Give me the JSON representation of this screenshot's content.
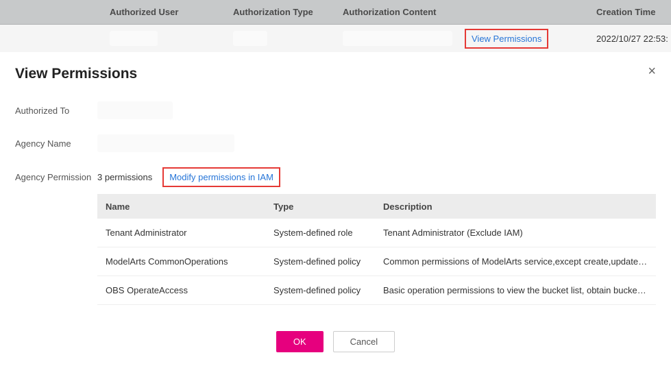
{
  "main_table": {
    "headers": {
      "user": "Authorized User",
      "type": "Authorization Type",
      "content": "Authorization Content",
      "time": "Creation Time"
    },
    "row": {
      "view_link": "View Permissions",
      "time": "2022/10/27 22:53:"
    }
  },
  "dialog": {
    "title": "View Permissions",
    "close": "×",
    "fields": {
      "authorized_to_label": "Authorized To",
      "agency_name_label": "Agency Name",
      "agency_permission_label": "Agency Permission",
      "permission_count": "3 permissions",
      "modify_link": "Modify permissions in IAM"
    },
    "perm_table": {
      "headers": {
        "name": "Name",
        "type": "Type",
        "desc": "Description"
      },
      "rows": [
        {
          "name": "Tenant Administrator",
          "type": "System-defined role",
          "desc": "Tenant Administrator (Exclude IAM)"
        },
        {
          "name": "ModelArts CommonOperations",
          "type": "System-defined policy",
          "desc": "Common permissions of ModelArts service,except create,update,dele…"
        },
        {
          "name": "OBS OperateAccess",
          "type": "System-defined policy",
          "desc": "Basic operation permissions to view the bucket list, obtain bucket me…"
        }
      ]
    },
    "buttons": {
      "ok": "OK",
      "cancel": "Cancel"
    }
  }
}
